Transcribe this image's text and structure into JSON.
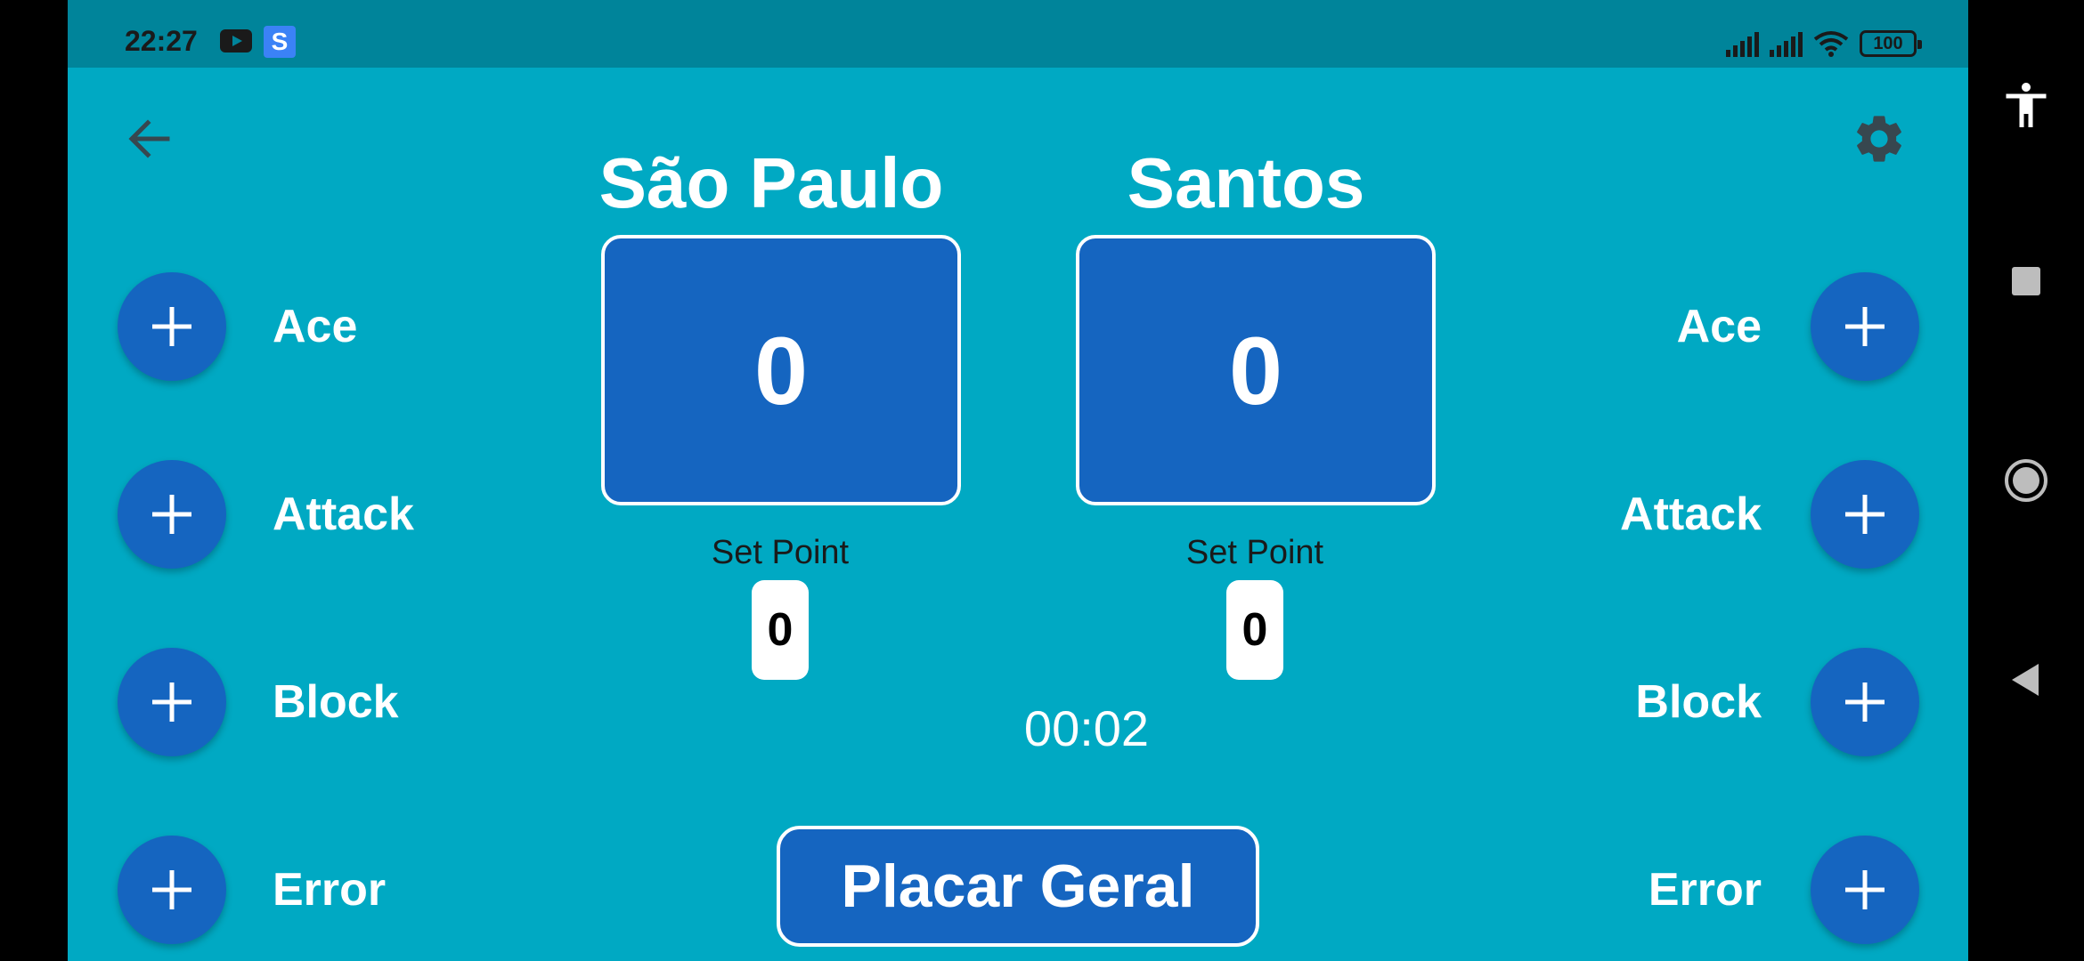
{
  "status_bar": {
    "time": "22:27",
    "battery": "100",
    "icons": [
      "youtube-icon",
      "s-app-icon",
      "signal-icon",
      "signal-icon",
      "wifi-icon",
      "battery-icon"
    ]
  },
  "header": {
    "back_icon": "arrow-left-icon",
    "settings_icon": "gear-icon"
  },
  "teams": [
    {
      "name": "São Paulo",
      "score": "0",
      "set_point_label": "Set Point",
      "set_point": "0"
    },
    {
      "name": "Santos",
      "score": "0",
      "set_point_label": "Set Point",
      "set_point": "0"
    }
  ],
  "stats": {
    "left": [
      {
        "label": "Ace"
      },
      {
        "label": "Attack"
      },
      {
        "label": "Block"
      },
      {
        "label": "Error"
      }
    ],
    "right": [
      {
        "label": "Ace"
      },
      {
        "label": "Attack"
      },
      {
        "label": "Block"
      },
      {
        "label": "Error"
      }
    ]
  },
  "timer": "00:02",
  "placar_button": "Placar Geral",
  "nav_bar": {
    "icons": [
      "accessibility-icon",
      "recents-icon",
      "home-icon",
      "back-icon"
    ]
  },
  "colors": {
    "background": "#00a9c3",
    "status_bar": "#00849a",
    "primary": "#1565c0",
    "text": "#ffffff"
  }
}
